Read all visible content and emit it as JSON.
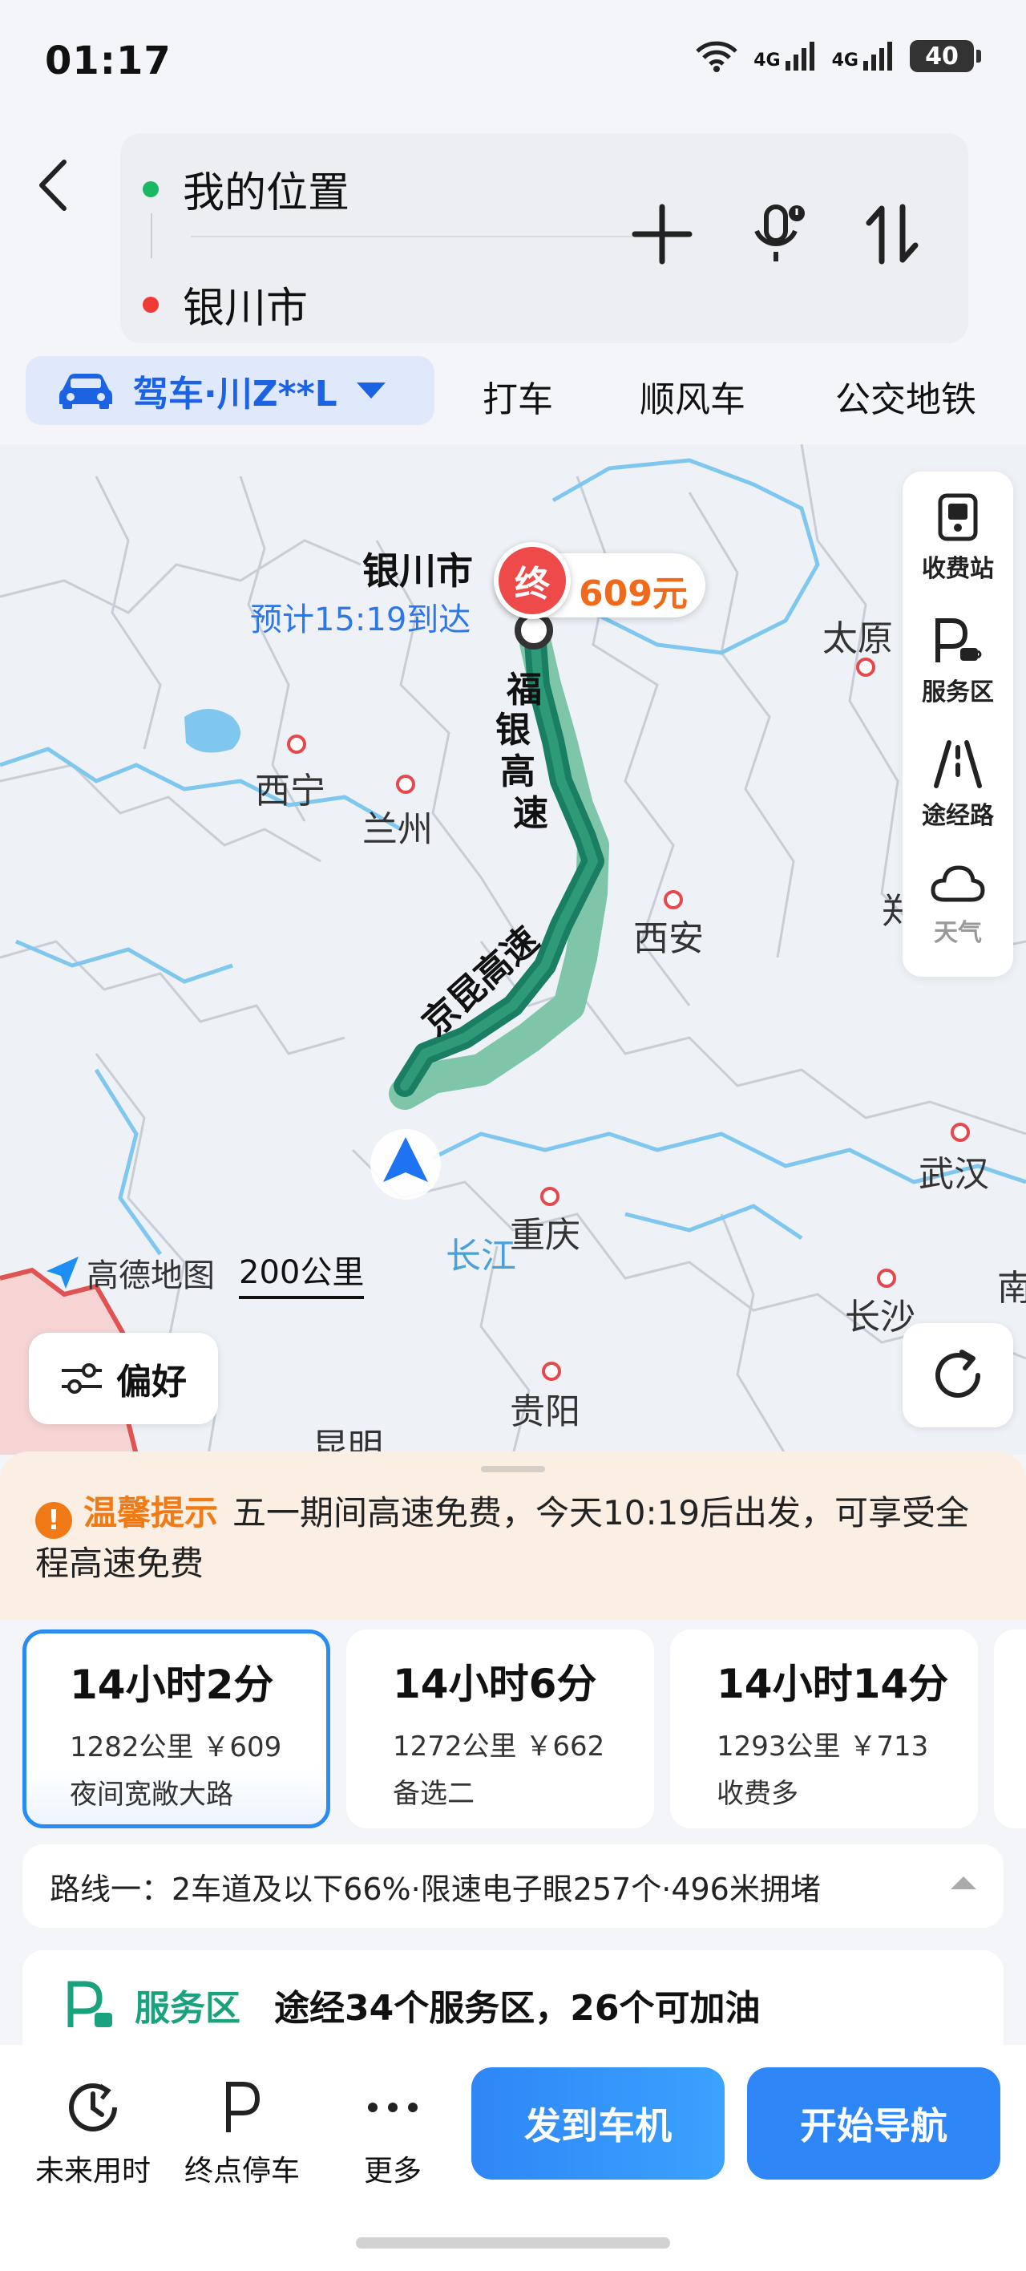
{
  "status": {
    "time": "01:17",
    "net1": "4G",
    "net2": "4G",
    "battery": "40"
  },
  "search": {
    "origin": "我的位置",
    "destination": "银川市"
  },
  "modes": {
    "active_label": "驾车·川Z**L",
    "taxi": "打车",
    "carpool": "顺风车",
    "transit": "公交地铁"
  },
  "map": {
    "destination_label": "银川市",
    "eta": "预计15:19到达",
    "pin_label": "终",
    "toll_price": "609元",
    "roads": {
      "north_chars": [
        "福",
        "银",
        "高",
        "速"
      ],
      "south": "京昆高速"
    },
    "cities": {
      "taiyuan": "太原",
      "xining": "西宁",
      "lanzhou": "兰州",
      "xian": "西安",
      "wuhan": "武汉",
      "chongqing": "重庆",
      "changsha": "长沙",
      "guiyang": "贵阳",
      "kunming": "昆明",
      "nan": "南",
      "zheng": "郑"
    },
    "river": "长江",
    "tools": {
      "toll": "收费站",
      "service": "服务区",
      "via": "途经路",
      "weather": "天气"
    },
    "logo": "高德地图",
    "scale": "200公里",
    "preference": "偏好"
  },
  "notice": {
    "title": "温馨提示",
    "text": "五一期间高速免费，今天10:19后出发，可享受全程高速免费"
  },
  "routes": [
    {
      "time": "14小时2分",
      "meta": "1282公里 ￥609",
      "tag": "夜间宽敞大路"
    },
    {
      "time": "14小时6分",
      "meta": "1272公里 ￥662",
      "tag": "备选二"
    },
    {
      "time": "14小时14分",
      "meta": "1293公里 ￥713",
      "tag": "收费多"
    }
  ],
  "route_detail": "路线一：2车道及以下66%·限速电子眼257个·496米拥堵",
  "service": {
    "label": "服务区",
    "text": "途经34个服务区，26个可加油"
  },
  "bottom": {
    "future": "未来用时",
    "parking": "终点停车",
    "more": "更多",
    "send": "发到车机",
    "start": "开始导航"
  },
  "colors": {
    "accent": "#2f86f6",
    "route": "#1a7f62",
    "warning": "#f07b16"
  }
}
